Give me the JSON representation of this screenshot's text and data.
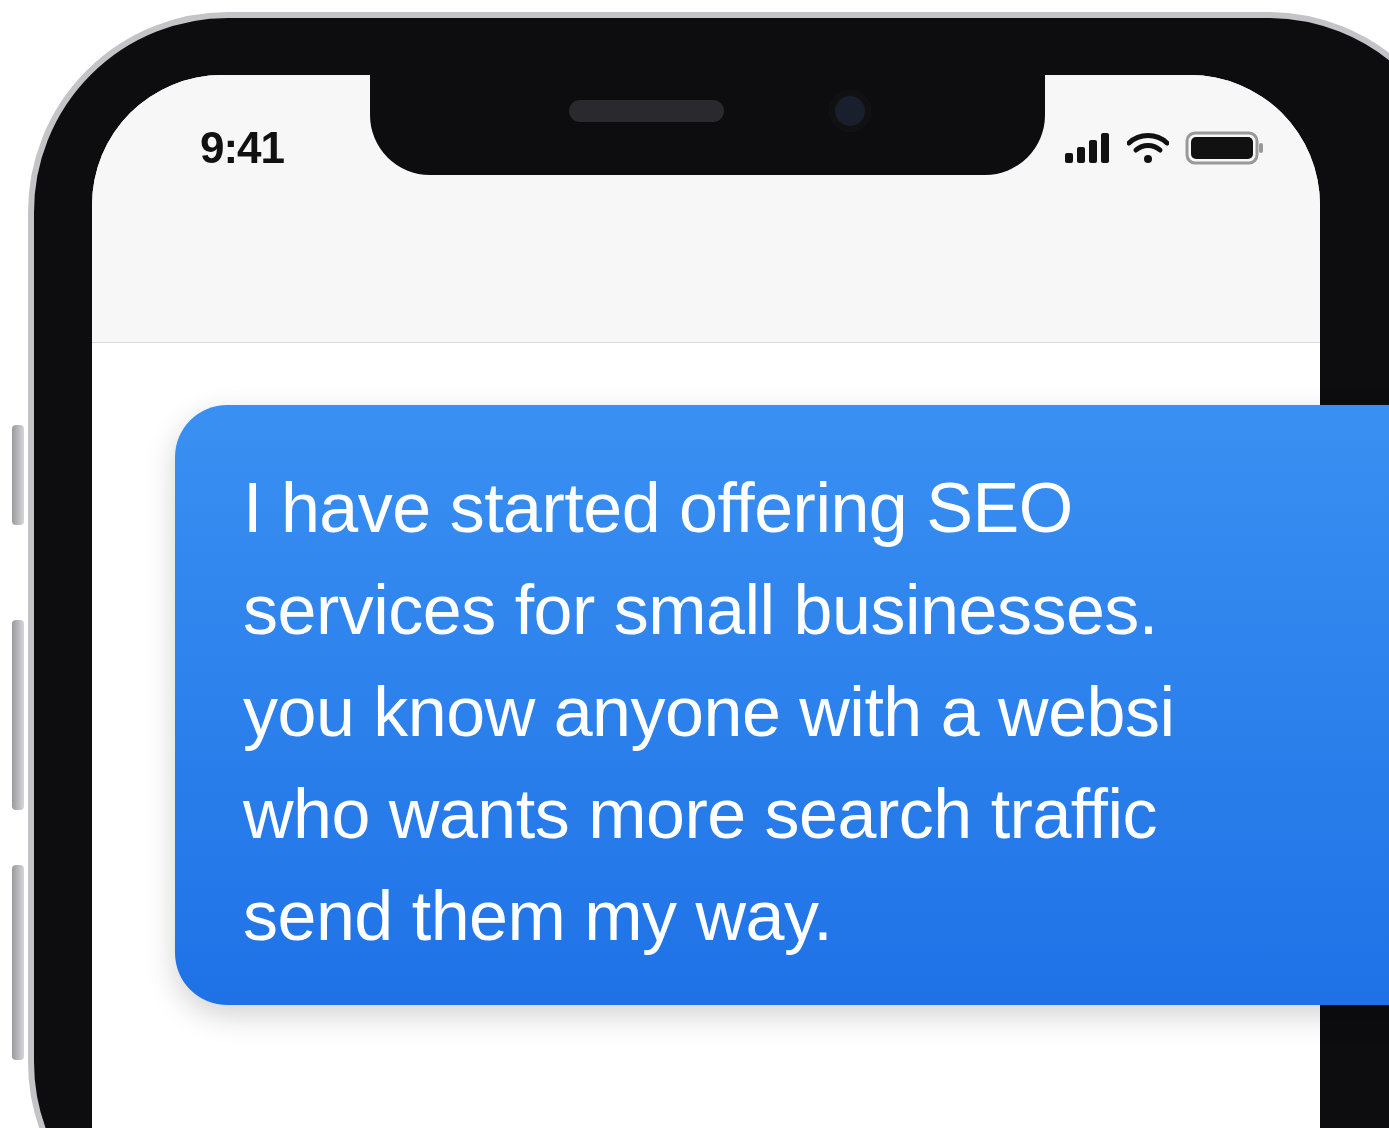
{
  "status_bar": {
    "time": "9:41"
  },
  "messages": [
    {
      "lines": [
        "I have started offering SEO",
        "services for small businesses.",
        "you know anyone with a websi",
        "who wants more search traffic",
        "send them my way."
      ]
    }
  ]
}
